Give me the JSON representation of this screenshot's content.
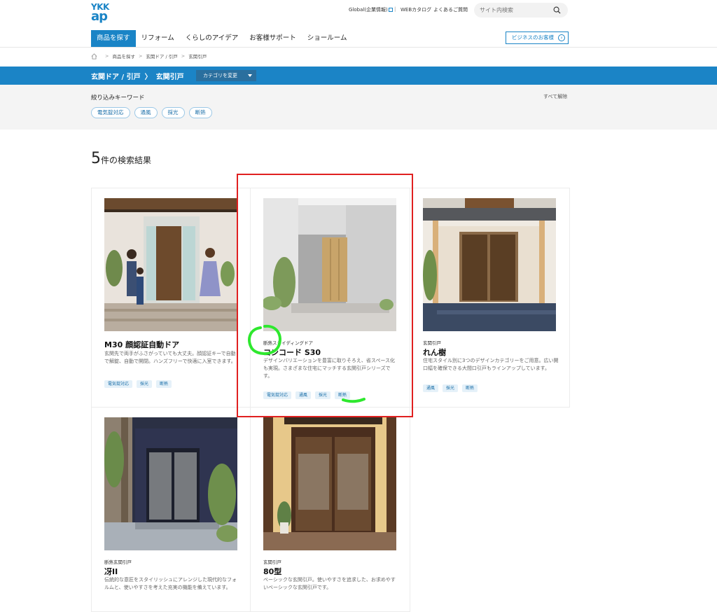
{
  "header": {
    "logo_line1": "YKK",
    "logo_line2": "ap",
    "global_link": "Global(企業情報)",
    "separator": "|",
    "catalog_link": "WEBカタログ",
    "faq_link": "よくあるご質問",
    "search_placeholder": "サイト内検索"
  },
  "nav": {
    "items": [
      {
        "label": "商品を探す"
      },
      {
        "label": "リフォーム"
      },
      {
        "label": "くらしのアイデア"
      },
      {
        "label": "お客様サポート"
      },
      {
        "label": "ショールーム"
      }
    ],
    "business_button": "ビジネスのお客様"
  },
  "breadcrumb": {
    "items": [
      "商品を探す",
      "玄関ドア / 引戸",
      "玄関引戸"
    ],
    "separator": ">"
  },
  "band": {
    "parent": "玄関ドア / 引戸",
    "chevron": "〉",
    "current": "玄関引戸",
    "category_button": "カテゴリを変更"
  },
  "filter": {
    "label": "絞り込みキーワード",
    "clear_all": "すべて解除",
    "chips": [
      "電気錠対応",
      "通風",
      "採光",
      "断熱"
    ]
  },
  "results": {
    "count": "5",
    "suffix": "件の検索結果"
  },
  "cards": [
    {
      "category": "",
      "title": "M30 顔認証自動ドア",
      "description": "玄関先で両手がふさがっていても大丈夫。顔認証キーで自動で解錠、自動で開閉。ハンズフリーで快適に入室できます。",
      "tags": [
        "電気錠対応",
        "採光",
        "断熱"
      ]
    },
    {
      "category": "断熱スライディングドア",
      "title": "コンコード S30",
      "description": "デザインバリエーションを豊富に取りそろえ、省スペース化も実現。さまざまな住宅にマッチする玄関引戸シリーズです。",
      "tags": [
        "電気錠対応",
        "通風",
        "採光",
        "断熱"
      ]
    },
    {
      "category": "玄関引戸",
      "title": "れん樹",
      "description": "住宅スタイル別に3つのデザインカテゴリーをご用意。広い開口幅を確保できる大間口引戸もラインアップしています。",
      "tags": [
        "通風",
        "採光",
        "断熱"
      ]
    },
    {
      "category": "断熱玄関引戸",
      "title": "冴II",
      "description": "伝統的な意匠をスタイリッシュにアレンジした現代的なフォルムと、使いやすさを考えた充実の機能を備えています。",
      "tags": []
    },
    {
      "category": "玄関引戸",
      "title": "80型",
      "description": "ベーシックな玄関引戸。使いやすさを追求した、お求めやすいベーシックな玄関引戸です。",
      "tags": []
    }
  ],
  "colors": {
    "brand_blue": "#1a84c6",
    "annotation_red": "#e02020",
    "annotation_green": "#2ee82e"
  },
  "icons": [
    "search-icon",
    "home-icon",
    "external-link-icon",
    "arrow-right-circle-icon",
    "caret-down-icon"
  ]
}
